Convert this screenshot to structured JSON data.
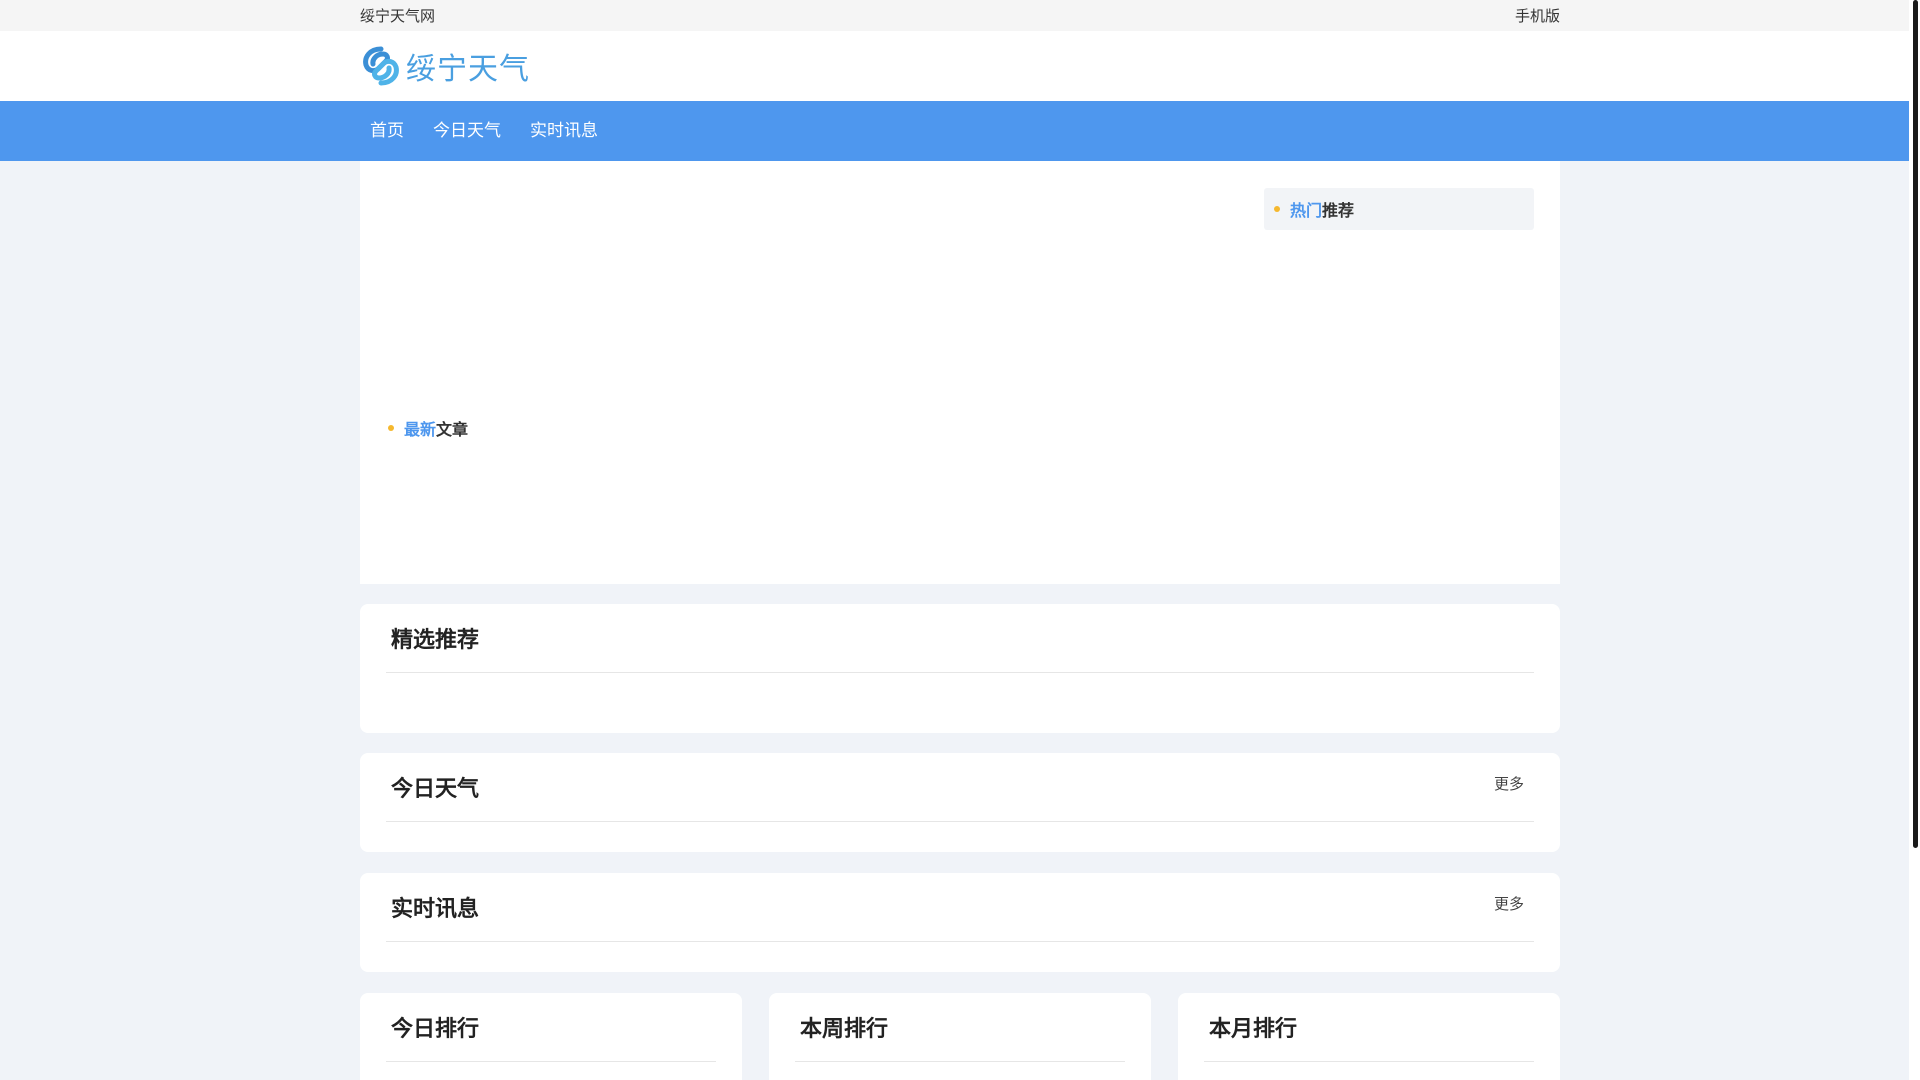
{
  "topbar": {
    "site_name": "绥宁天气网",
    "mobile": "手机版"
  },
  "header": {
    "logo_text": "绥宁天气",
    "logo_color": "#4a9fe0"
  },
  "nav": {
    "items": [
      {
        "label": "首页"
      },
      {
        "label": "今日天气"
      },
      {
        "label": "实时讯息"
      }
    ],
    "bg": "#4e97ee"
  },
  "hero": {
    "hot": {
      "highlight": "热门",
      "rest": "推荐"
    },
    "latest": {
      "highlight": "最新",
      "rest": "文章"
    }
  },
  "sections": {
    "featured": {
      "title": "精选推荐"
    },
    "today": {
      "title": "今日天气",
      "more": "更多"
    },
    "live": {
      "title": "实时讯息",
      "more": "更多"
    }
  },
  "rankings": [
    {
      "title": "今日排行"
    },
    {
      "title": "本周排行"
    },
    {
      "title": "本月排行"
    }
  ]
}
